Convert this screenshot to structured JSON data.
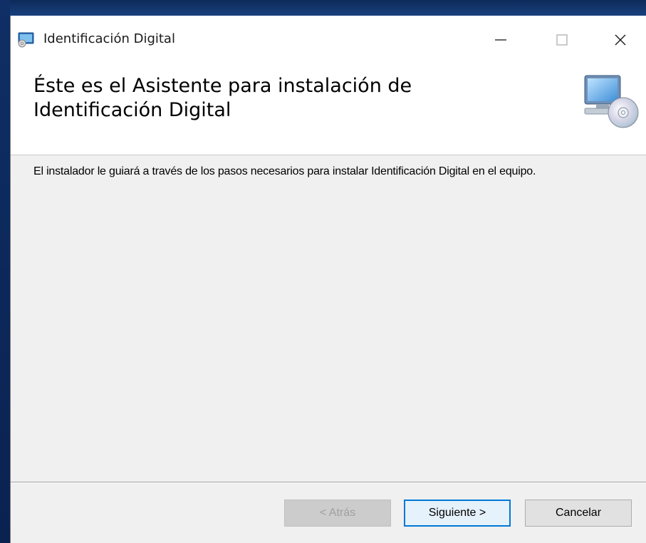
{
  "window": {
    "title": "Identificación Digital",
    "controls": {
      "minimize": "minimize-icon",
      "maximize": "maximize-icon",
      "close": "close-icon"
    }
  },
  "header": {
    "title": "Éste es el Asistente para instalación de Identificación Digital",
    "icon": "computer-cd-icon"
  },
  "body": {
    "text": "El instalador le guiará a través de los pasos necesarios para instalar Identificación Digital en el equipo."
  },
  "buttons": {
    "back": "< Atrás",
    "next": "Siguiente >",
    "cancel": "Cancelar"
  },
  "colors": {
    "accent": "#0078d7",
    "window_bg": "#f0f0f0",
    "header_bg": "#ffffff"
  }
}
